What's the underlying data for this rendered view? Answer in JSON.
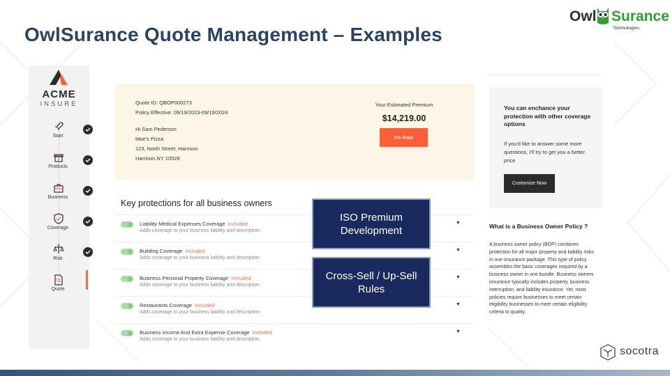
{
  "slide": {
    "title": "OwlSurance Quote Management  – Examples"
  },
  "owl_logo": {
    "owl": "Owl",
    "surance": "Surance",
    "tagline": "Technologies"
  },
  "sidebar": {
    "brand": "ACME",
    "brand_sub": "INSURE",
    "steps": [
      {
        "label": "Start",
        "icon": "rocket-icon",
        "complete": true
      },
      {
        "label": "Products",
        "icon": "gift-icon",
        "complete": true
      },
      {
        "label": "Business",
        "icon": "briefcase-icon",
        "complete": true
      },
      {
        "label": "Coverage",
        "icon": "shield-check-icon",
        "complete": true
      },
      {
        "label": "Risk",
        "icon": "scale-icon",
        "complete": true
      },
      {
        "label": "Quote",
        "icon": "document-icon",
        "complete": false,
        "active": true
      }
    ]
  },
  "quote": {
    "quote_id": "Quote ID: QBOP000273",
    "policy_effective": "Policy Effective: 09/19/2023-09/19/2024",
    "greeting": "Hi Sam Pederson",
    "business_name": "Moe's Pizza",
    "address_line1": "123, North Street, Harrison",
    "address_line2": "Harrison,NY 10528",
    "premium_label": "Your Estimated Premium",
    "premium_value": "$14,219.00",
    "rerate_label": "Re-Rate"
  },
  "protections": {
    "title": "Key protections for all business owners",
    "items": [
      {
        "name": "Liability Medical Expenses Coverage",
        "status": "Included",
        "description": "Adds coverage to your business liability and description"
      },
      {
        "name": "Building Coverage",
        "status": "Included",
        "description": "Adds coverage to your business liability and description"
      },
      {
        "name": "Business Personal Property Coverage",
        "status": "Included",
        "description": "Adds coverage to your business liability and description"
      },
      {
        "name": "Restaurants Coverage",
        "status": "Included",
        "description": "Adds coverage to your business liability and description"
      },
      {
        "name": "Business Income And Extra Expense Coverage",
        "status": "Included",
        "description": "Adds coverage to your business liability and description"
      }
    ],
    "chevron": "▼"
  },
  "overlays": {
    "iso": "ISO Premium Development",
    "cross_sell": "Cross-Sell / Up-Sell Rules"
  },
  "right_panel": {
    "heading": "You can enchance your protection with other coverage options",
    "body": "If you'd like to answer some more questions, I'll try to get you a better price",
    "customize_label": "Customize Now",
    "bop_title": "What is a Business Owner Policy ?",
    "bop_body": "A business owner policy (BOP) combines protection for all major property and liability risks in one insurance package. This type of policy assembles the basic coverages required by a business owner in one bundle. Business owners insurance typically includes property, business interruption, and liability insurance. Yet, most policies require businesses to meet certain eligibility businesses to meet certain eligibility criteria to quality."
  },
  "socotra_logo": {
    "text": "socotra"
  },
  "colors": {
    "title": "#2a4364",
    "accent_orange": "#fb5f3a",
    "overlay_navy": "#1b2a5e",
    "brand_green": "#2f9f35"
  }
}
